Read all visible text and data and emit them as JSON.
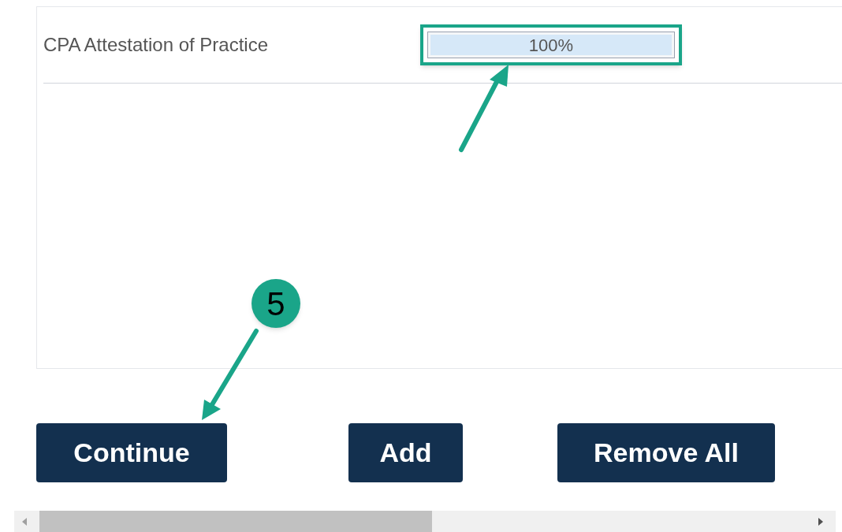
{
  "rows": [
    {
      "name": "CPA Attestation of Practice",
      "level": 1,
      "reading": "100%",
      "highlighted": true
    }
  ],
  "callout": {
    "number": "5"
  },
  "buttons": [
    {
      "label": "Continue"
    },
    {
      "label": "Add"
    },
    {
      "label": "Remove All"
    }
  ]
}
